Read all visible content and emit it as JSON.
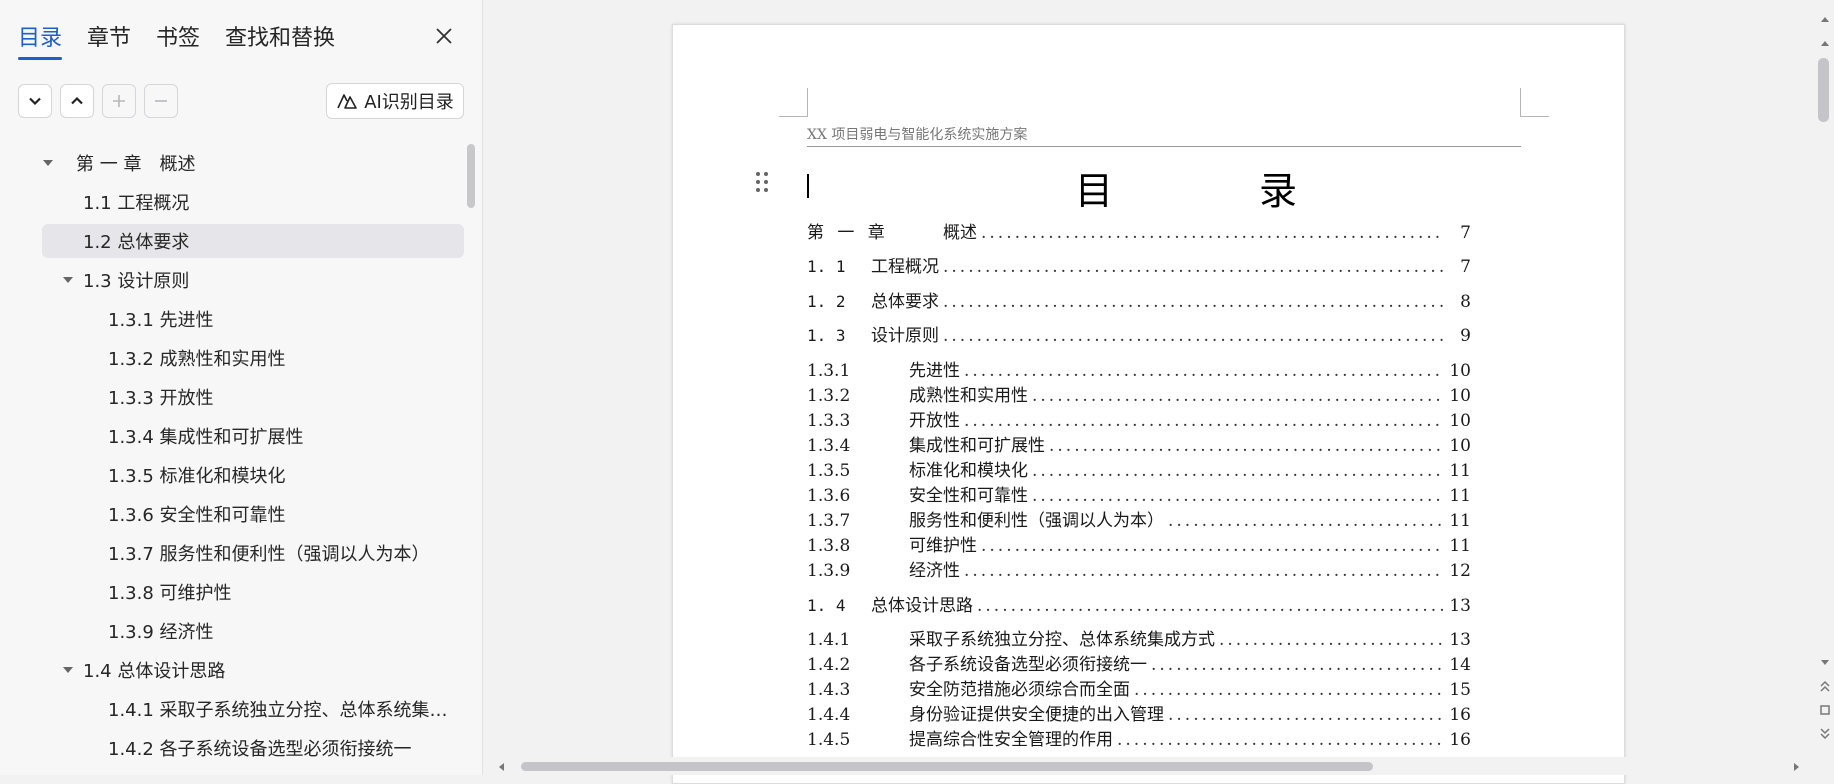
{
  "side_panel": {
    "tabs": [
      {
        "label": "目录"
      },
      {
        "label": "章节"
      },
      {
        "label": "书签"
      },
      {
        "label": "查找和替换"
      }
    ],
    "ai_button_label": "AI识别目录",
    "tree": [
      {
        "label": "第 一 章　概述",
        "expanded": true
      },
      {
        "label": "1.1 工程概况"
      },
      {
        "label": "1.2 总体要求",
        "selected": true
      },
      {
        "label": "1.3 设计原则",
        "expanded": true
      },
      {
        "label": "1.3.1 先进性"
      },
      {
        "label": "1.3.2 成熟性和实用性"
      },
      {
        "label": "1.3.3 开放性"
      },
      {
        "label": "1.3.4 集成性和可扩展性"
      },
      {
        "label": "1.3.5 标准化和模块化"
      },
      {
        "label": "1.3.6 安全性和可靠性"
      },
      {
        "label": "1.3.7 服务性和便利性（强调以人为本）"
      },
      {
        "label": "1.3.8 可维护性"
      },
      {
        "label": "1.3.9 经济性"
      },
      {
        "label": "1.4 总体设计思路",
        "expanded": true
      },
      {
        "label": "1.4.1 采取子系统独立分控、总体系统集…"
      },
      {
        "label": "1.4.2 各子系统设备选型必须衔接统一"
      }
    ]
  },
  "document": {
    "header_text": "XX 项目弱电与智能化系统实施方案",
    "toc_title": "目　录",
    "toc": [
      {
        "num": "第 一 章",
        "title": "概述",
        "page": "7"
      },
      {
        "num": "1. 1",
        "title": "工程概况",
        "page": "7"
      },
      {
        "num": "1. 2",
        "title": "总体要求",
        "page": "8"
      },
      {
        "num": "1. 3",
        "title": "设计原则",
        "page": "9"
      },
      {
        "num": "1.3.1",
        "title": "先进性",
        "page": "10"
      },
      {
        "num": "1.3.2",
        "title": "成熟性和实用性",
        "page": "10"
      },
      {
        "num": "1.3.3",
        "title": "开放性",
        "page": "10"
      },
      {
        "num": "1.3.4",
        "title": "集成性和可扩展性",
        "page": "10"
      },
      {
        "num": "1.3.5",
        "title": "标准化和模块化",
        "page": "11"
      },
      {
        "num": "1.3.6",
        "title": "安全性和可靠性",
        "page": "11"
      },
      {
        "num": "1.3.7",
        "title": "服务性和便利性（强调以人为本）",
        "page": "11"
      },
      {
        "num": "1.3.8",
        "title": "可维护性",
        "page": "11"
      },
      {
        "num": "1.3.9",
        "title": "经济性",
        "page": "12"
      },
      {
        "num": "1. 4",
        "title": "总体设计思路",
        "page": "13"
      },
      {
        "num": "1.4.1",
        "title": "采取子系统独立分控、总体系统集成方式",
        "page": "13"
      },
      {
        "num": "1.4.2",
        "title": "各子系统设备选型必须衔接统一",
        "page": "14"
      },
      {
        "num": "1.4.3",
        "title": "安全防范措施必须综合而全面",
        "page": "15"
      },
      {
        "num": "1.4.4",
        "title": "身份验证提供安全便捷的出入管理",
        "page": "16"
      },
      {
        "num": "1.4.5",
        "title": "提高综合性安全管理的作用",
        "page": "16"
      }
    ]
  },
  "icons": {
    "close": "close-icon",
    "expand_all": "chevron-down-icon",
    "collapse_all": "chevron-up-icon",
    "add": "plus-icon",
    "remove": "minus-icon",
    "ai": "ai-toc-icon",
    "drag": "drag-handle-icon"
  },
  "colors": {
    "accent": "#1d5fcc",
    "selected_row": "#e6e6ea"
  }
}
